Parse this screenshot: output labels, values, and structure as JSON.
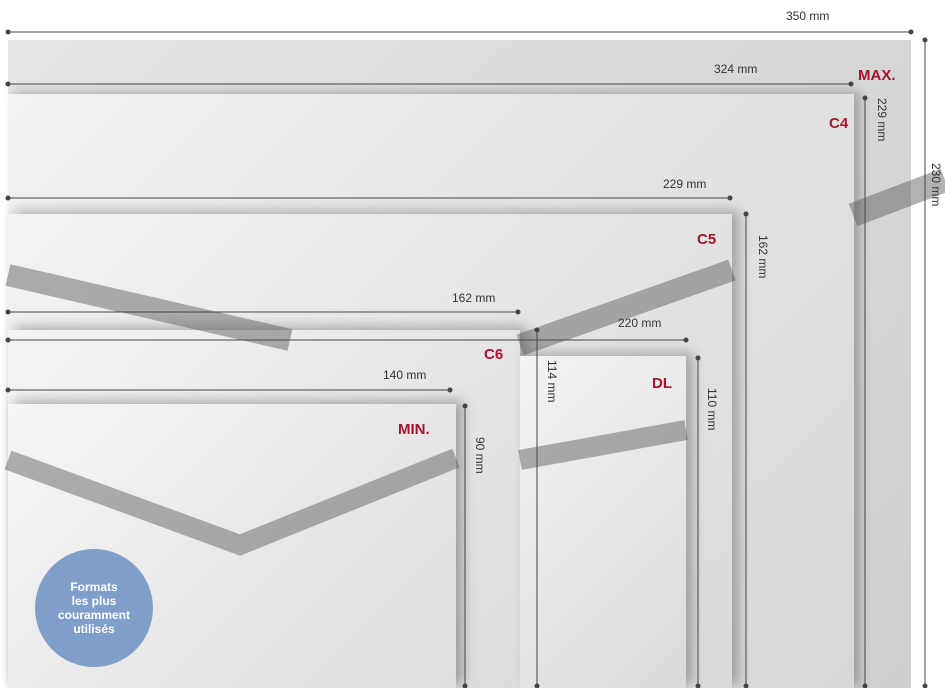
{
  "formats": {
    "max": "MAX.",
    "c4": "C4",
    "c5": "C5",
    "c6": "C6",
    "dl": "DL",
    "min": "MIN."
  },
  "dimensions": {
    "max_width": "350 mm",
    "max_height": "230 mm",
    "c4_width": "324 mm",
    "c4_height": "229 mm",
    "c5_width": "229 mm",
    "c5_height": "162 mm",
    "c6_width": "162 mm",
    "c6_height": "114 mm",
    "dl_width": "220 mm",
    "dl_height": "110 mm",
    "min_width": "140 mm",
    "min_height": "90 mm"
  },
  "badge": {
    "text": "Formats\nles plus\ncouramment\nutilisés"
  },
  "colors": {
    "format_label": "#a8122a",
    "badge": "#7f9fc9",
    "dimension_line": "#444444"
  }
}
